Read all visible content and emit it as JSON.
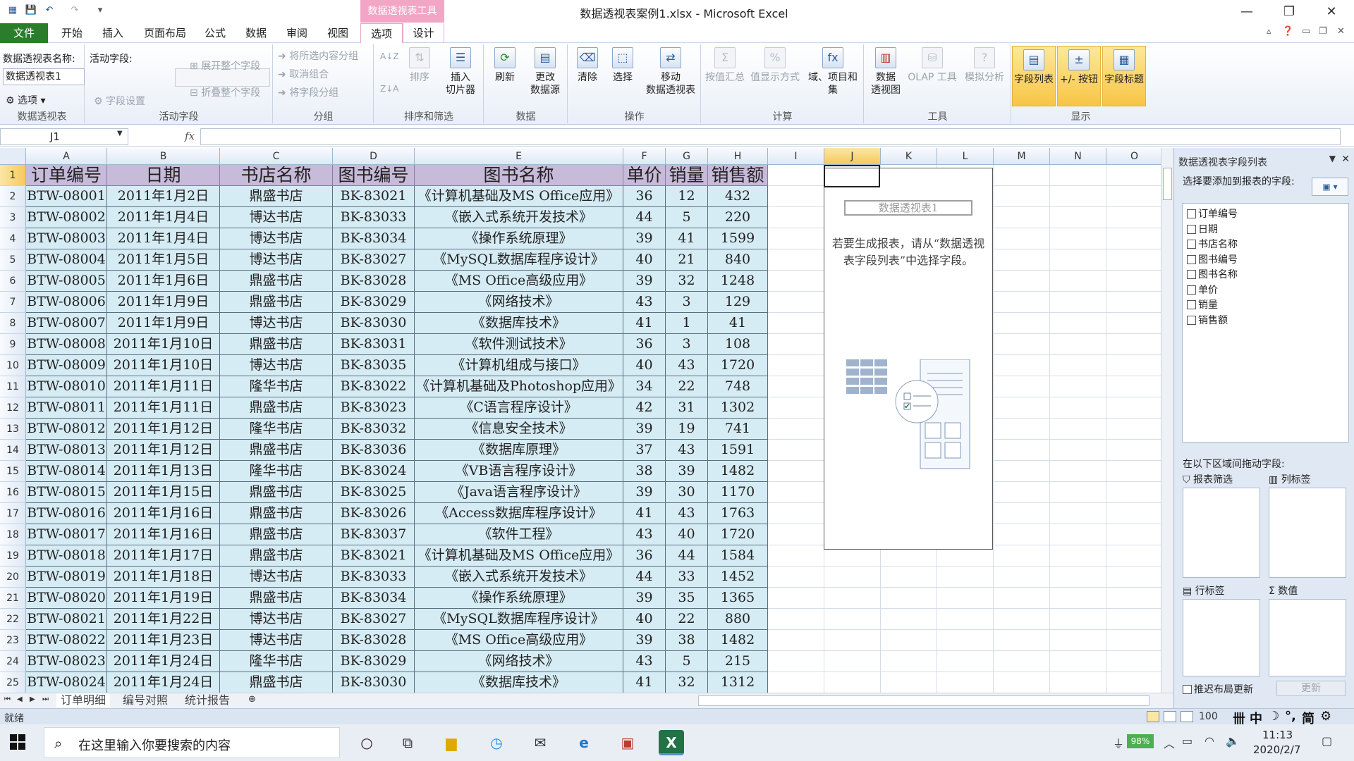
{
  "window": {
    "title": "数据透视表案例1.xlsx - Microsoft Excel",
    "context_tab_group": "数据透视表工具",
    "minimize": "—",
    "restore": "❐",
    "close": "✕"
  },
  "tabs": [
    "文件",
    "开始",
    "插入",
    "页面布局",
    "公式",
    "数据",
    "审阅",
    "视图",
    "选项",
    "设计"
  ],
  "ribbon": {
    "pivot_name_label": "数据透视表名称:",
    "pivot_name_value": "数据透视表1",
    "options_label": "选项",
    "group_pivot": "数据透视表",
    "active_field_label": "活动字段:",
    "field_settings": "字段设置",
    "expand_field": "展开整个字段",
    "collapse_field": "折叠整个字段",
    "group_active_field": "活动字段",
    "group_selection": "将所选内容分组",
    "ungroup": "取消组合",
    "group_field": "将字段分组",
    "group_group": "分组",
    "sort_asc": "A↓Z",
    "sort_desc": "Z↓A",
    "sort": "排序",
    "insert_slicer": "插入\n切片器",
    "group_sort_filter": "排序和筛选",
    "refresh": "刷新",
    "change_source": "更改\n数据源",
    "group_data": "数据",
    "clear": "清除",
    "select": "选择",
    "move_pivot": "移动\n数据透视表",
    "group_actions": "操作",
    "summarize_by": "按值汇总",
    "show_values_as": "值显示方式",
    "fields_items_sets": "域、项目和\n集",
    "group_calc": "计算",
    "pivot_chart": "数据\n透视图",
    "olap_tools": "OLAP 工具",
    "what_if": "模拟分析",
    "group_tools": "工具",
    "field_list": "字段列表",
    "plus_minus_buttons": "+/- 按钮",
    "field_headers": "字段标题",
    "group_show": "显示"
  },
  "formula_bar": {
    "name_box": "J1",
    "fx": "fx",
    "formula": ""
  },
  "columns": [
    "A",
    "B",
    "C",
    "D",
    "E",
    "F",
    "G",
    "H",
    "I",
    "J",
    "K",
    "L",
    "M",
    "N",
    "O"
  ],
  "table_headers": [
    "订单编号",
    "日期",
    "书店名称",
    "图书编号",
    "图书名称",
    "单价",
    "销量",
    "销售额"
  ],
  "rows": [
    [
      "BTW-08001",
      "2011年1月2日",
      "鼎盛书店",
      "BK-83021",
      "《计算机基础及MS Office应用》",
      "36",
      "12",
      "432"
    ],
    [
      "BTW-08002",
      "2011年1月4日",
      "博达书店",
      "BK-83033",
      "《嵌入式系统开发技术》",
      "44",
      "5",
      "220"
    ],
    [
      "BTW-08003",
      "2011年1月4日",
      "博达书店",
      "BK-83034",
      "《操作系统原理》",
      "39",
      "41",
      "1599"
    ],
    [
      "BTW-08004",
      "2011年1月5日",
      "博达书店",
      "BK-83027",
      "《MySQL数据库程序设计》",
      "40",
      "21",
      "840"
    ],
    [
      "BTW-08005",
      "2011年1月6日",
      "鼎盛书店",
      "BK-83028",
      "《MS Office高级应用》",
      "39",
      "32",
      "1248"
    ],
    [
      "BTW-08006",
      "2011年1月9日",
      "鼎盛书店",
      "BK-83029",
      "《网络技术》",
      "43",
      "3",
      "129"
    ],
    [
      "BTW-08007",
      "2011年1月9日",
      "博达书店",
      "BK-83030",
      "《数据库技术》",
      "41",
      "1",
      "41"
    ],
    [
      "BTW-08008",
      "2011年1月10日",
      "鼎盛书店",
      "BK-83031",
      "《软件测试技术》",
      "36",
      "3",
      "108"
    ],
    [
      "BTW-08009",
      "2011年1月10日",
      "博达书店",
      "BK-83035",
      "《计算机组成与接口》",
      "40",
      "43",
      "1720"
    ],
    [
      "BTW-08010",
      "2011年1月11日",
      "隆华书店",
      "BK-83022",
      "《计算机基础及Photoshop应用》",
      "34",
      "22",
      "748"
    ],
    [
      "BTW-08011",
      "2011年1月11日",
      "鼎盛书店",
      "BK-83023",
      "《C语言程序设计》",
      "42",
      "31",
      "1302"
    ],
    [
      "BTW-08012",
      "2011年1月12日",
      "隆华书店",
      "BK-83032",
      "《信息安全技术》",
      "39",
      "19",
      "741"
    ],
    [
      "BTW-08013",
      "2011年1月12日",
      "鼎盛书店",
      "BK-83036",
      "《数据库原理》",
      "37",
      "43",
      "1591"
    ],
    [
      "BTW-08014",
      "2011年1月13日",
      "隆华书店",
      "BK-83024",
      "《VB语言程序设计》",
      "38",
      "39",
      "1482"
    ],
    [
      "BTW-08015",
      "2011年1月15日",
      "鼎盛书店",
      "BK-83025",
      "《Java语言程序设计》",
      "39",
      "30",
      "1170"
    ],
    [
      "BTW-08016",
      "2011年1月16日",
      "鼎盛书店",
      "BK-83026",
      "《Access数据库程序设计》",
      "41",
      "43",
      "1763"
    ],
    [
      "BTW-08017",
      "2011年1月16日",
      "鼎盛书店",
      "BK-83037",
      "《软件工程》",
      "43",
      "40",
      "1720"
    ],
    [
      "BTW-08018",
      "2011年1月17日",
      "鼎盛书店",
      "BK-83021",
      "《计算机基础及MS Office应用》",
      "36",
      "44",
      "1584"
    ],
    [
      "BTW-08019",
      "2011年1月18日",
      "博达书店",
      "BK-83033",
      "《嵌入式系统开发技术》",
      "44",
      "33",
      "1452"
    ],
    [
      "BTW-08020",
      "2011年1月19日",
      "鼎盛书店",
      "BK-83034",
      "《操作系统原理》",
      "39",
      "35",
      "1365"
    ],
    [
      "BTW-08021",
      "2011年1月22日",
      "博达书店",
      "BK-83027",
      "《MySQL数据库程序设计》",
      "40",
      "22",
      "880"
    ],
    [
      "BTW-08022",
      "2011年1月23日",
      "博达书店",
      "BK-83028",
      "《MS Office高级应用》",
      "39",
      "38",
      "1482"
    ],
    [
      "BTW-08023",
      "2011年1月24日",
      "隆华书店",
      "BK-83029",
      "《网络技术》",
      "43",
      "5",
      "215"
    ],
    [
      "BTW-08024",
      "2011年1月24日",
      "鼎盛书店",
      "BK-83030",
      "《数据库技术》",
      "41",
      "32",
      "1312"
    ]
  ],
  "pivot": {
    "name": "数据透视表1",
    "message": "若要生成报表，请从“数据透视表字段列表”中选择字段。"
  },
  "sheets": [
    "订单明细",
    "编号对照",
    "统计报告"
  ],
  "field_list": {
    "title": "数据透视表字段列表",
    "instruction": "选择要添加到报表的字段:",
    "fields": [
      "订单编号",
      "日期",
      "书店名称",
      "图书编号",
      "图书名称",
      "单价",
      "销量",
      "销售额"
    ],
    "drag_label": "在以下区域间拖动字段:",
    "report_filter": "报表筛选",
    "column_labels": "列标签",
    "row_labels": "行标签",
    "values": "数值",
    "defer_update": "推迟布局更新",
    "update": "更新"
  },
  "status": {
    "ready": "就绪",
    "zoom": "100",
    "ime": [
      "中",
      "简"
    ]
  },
  "taskbar": {
    "search_placeholder": "在这里输入你要搜索的内容",
    "battery": "98%",
    "time": "11:13",
    "date": "2020/2/7"
  },
  "colors": {
    "header_fill": "#c8bad9",
    "data_fill": "#d6ecf4",
    "file_tab": "#2a7d2a",
    "context_tab": "#f3a5c5"
  }
}
